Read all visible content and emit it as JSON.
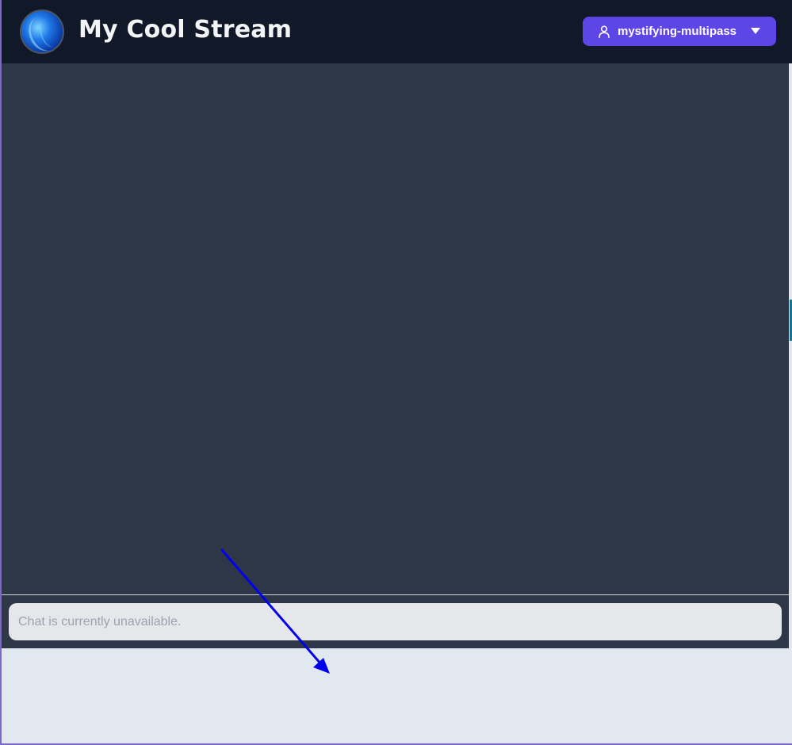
{
  "header": {
    "title": "My Cool Stream",
    "user_button": {
      "label": "mystifying-multipass",
      "icon": "user-icon",
      "caret_icon": "caret-down-icon",
      "color": "#5d45e8"
    }
  },
  "chat": {
    "placeholder": "Chat is currently unavailable."
  },
  "colors": {
    "header_bg": "#111827",
    "video_bg": "#2d3748",
    "chat_panel_bg": "#e2e8f0",
    "annotation_arrow": "#0000ee"
  }
}
